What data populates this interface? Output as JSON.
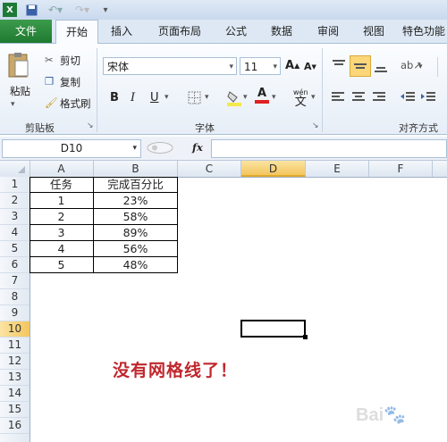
{
  "tabs": {
    "file": "文件",
    "home": "开始",
    "insert": "插入",
    "page_layout": "页面布局",
    "formulas": "公式",
    "data": "数据",
    "review": "审阅",
    "view": "视图",
    "special": "特色功能"
  },
  "clipboard": {
    "paste": "粘贴",
    "cut": "剪切",
    "copy": "复制",
    "format_painter": "格式刷",
    "group": "剪贴板"
  },
  "font": {
    "name": "宋体",
    "size": "11",
    "bold": "B",
    "italic": "I",
    "underline": "U",
    "group": "字体",
    "font_color": "A",
    "phonetic": "wén"
  },
  "alignment": {
    "group": "对齐方式"
  },
  "formula_bar": {
    "name_box": "D10",
    "fx": "fx"
  },
  "columns": [
    "A",
    "B",
    "C",
    "D",
    "E",
    "F"
  ],
  "rows": [
    "1",
    "2",
    "3",
    "4",
    "5",
    "6",
    "7",
    "8",
    "9",
    "10",
    "11",
    "12",
    "13",
    "14",
    "15",
    "16"
  ],
  "table": {
    "header": [
      "任务",
      "完成百分比"
    ],
    "rows": [
      [
        "1",
        "23%"
      ],
      [
        "2",
        "58%"
      ],
      [
        "3",
        "89%"
      ],
      [
        "4",
        "56%"
      ],
      [
        "5",
        "48%"
      ]
    ]
  },
  "annotation": "没有网格线了！",
  "colors": {
    "annotation": "#c0272d",
    "file_tab": "#2a8a3a",
    "selected_col": "#f7d36b"
  }
}
